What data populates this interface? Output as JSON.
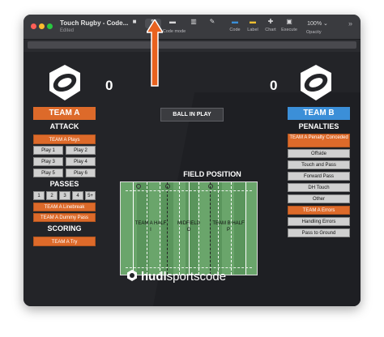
{
  "window": {
    "title": "Touch Rugby - Code...",
    "subtitle": "Edited",
    "toolbar": [
      {
        "icon": "video-icon",
        "label": ""
      },
      {
        "icon": "pointer-icon",
        "label": "Code mode"
      },
      {
        "icon": "window-icon",
        "label": ""
      },
      {
        "icon": "bars-icon",
        "label": ""
      },
      {
        "icon": "pen-icon",
        "label": ""
      },
      {
        "icon": "code-icon",
        "label": "Code"
      },
      {
        "icon": "label-icon",
        "label": "Label"
      },
      {
        "icon": "chart-icon",
        "label": "Chart"
      },
      {
        "icon": "execute-icon",
        "label": "Execute"
      }
    ],
    "opacity_value": "100%",
    "opacity_label": "Opacity"
  },
  "colors": {
    "orange": "#dd6a2a",
    "blue": "#3b8fd8",
    "field": "#6aa56b"
  },
  "team_a": {
    "score": "0",
    "name": "TEAM A",
    "attack_title": "ATTACK",
    "plays_button": "TEAM A Plays",
    "plays": [
      "Play 1",
      "Play 2",
      "Play 3",
      "Play 4",
      "Play 5",
      "Play 6"
    ],
    "passes_title": "PASSES",
    "passes": [
      "1",
      "2",
      "3",
      "4",
      "5+"
    ],
    "linebreak": "TEAM A Linebreak",
    "dummy_pass": "TEAM A Dummy Pass",
    "scoring_title": "SCORING",
    "try": "TEAM A Try"
  },
  "team_b": {
    "score": "0",
    "name": "TEAM B",
    "penalties_title": "PENALTIES",
    "penalty_conceded": "TEAM A Penalty Conceded",
    "penalties": [
      "Offside",
      "Touch and Pass",
      "Forward Pass",
      "DH Touch",
      "Other"
    ],
    "errors": "TEAM A Errors",
    "error_items": [
      "Handling Errors",
      "Pass to Ground"
    ]
  },
  "ball_in_play": "BALL IN PLAY",
  "field": {
    "title": "FIELD POSITION",
    "zones": [
      {
        "label": "TEAM A HALF",
        "code": "I"
      },
      {
        "label": "MIDFIELD",
        "code": "O"
      },
      {
        "label": "TEAM B HALF",
        "code": "P"
      }
    ]
  },
  "brand": {
    "bold": "hudl",
    "rest": "sportscode"
  }
}
